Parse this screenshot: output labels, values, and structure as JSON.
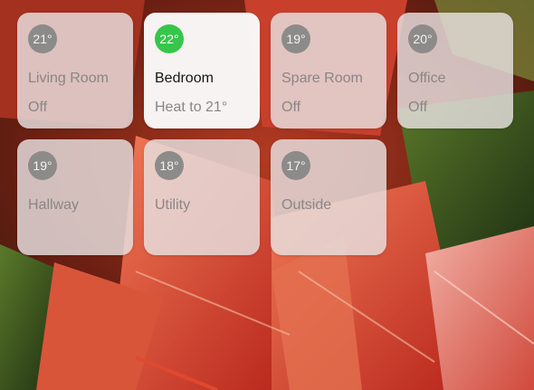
{
  "accessories": [
    {
      "name": "Living Room",
      "temperature": "21°",
      "status": "Off",
      "active": false
    },
    {
      "name": "Bedroom",
      "temperature": "22°",
      "status": "Heat to 21°",
      "active": true
    },
    {
      "name": "Spare Room",
      "temperature": "19°",
      "status": "Off",
      "active": false
    },
    {
      "name": "Office",
      "temperature": "20°",
      "status": "Off",
      "active": false
    },
    {
      "name": "Hallway",
      "temperature": "19°",
      "status": "",
      "active": false
    },
    {
      "name": "Utility",
      "temperature": "18°",
      "status": "",
      "active": false
    },
    {
      "name": "Outside",
      "temperature": "17°",
      "status": "",
      "active": false
    }
  ],
  "colors": {
    "active_badge": "#35c64a",
    "inactive_badge": "#8d8a8a",
    "tile_bg": "#e8e2e2"
  }
}
